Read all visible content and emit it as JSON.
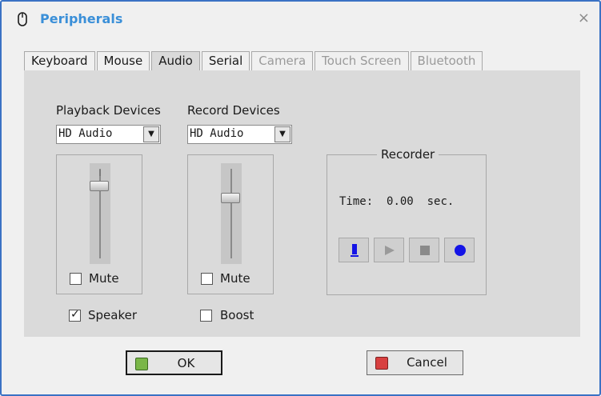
{
  "window": {
    "title": "Peripherals",
    "close": "×"
  },
  "tabs": [
    {
      "label": "Keyboard",
      "state": "normal"
    },
    {
      "label": "Mouse",
      "state": "normal"
    },
    {
      "label": "Audio",
      "state": "active"
    },
    {
      "label": "Serial",
      "state": "normal"
    },
    {
      "label": "Camera",
      "state": "disabled"
    },
    {
      "label": "Touch Screen",
      "state": "disabled"
    },
    {
      "label": "Bluetooth",
      "state": "disabled"
    }
  ],
  "playback": {
    "label": "Playback Devices",
    "device": "HD Audio",
    "volume_fraction": 0.85,
    "mute_label": "Mute",
    "mute_checked": false,
    "speaker_label": "Speaker",
    "speaker_checked": true
  },
  "record": {
    "label": "Record Devices",
    "device": "HD Audio",
    "volume_fraction": 0.7,
    "mute_label": "Mute",
    "mute_checked": false,
    "boost_label": "Boost",
    "boost_checked": false
  },
  "recorder": {
    "title": "Recorder",
    "time_label": "Time:",
    "time_value": "0.00",
    "time_unit": "sec.",
    "buttons": [
      "level-icon",
      "play-icon",
      "stop-icon",
      "record-icon"
    ]
  },
  "buttons": {
    "ok": "OK",
    "cancel": "Cancel"
  },
  "colors": {
    "title": "#3a8fd8",
    "accent_blue": "#1414e6",
    "ok_icon": "#7ab648",
    "cancel_icon": "#d84040"
  }
}
